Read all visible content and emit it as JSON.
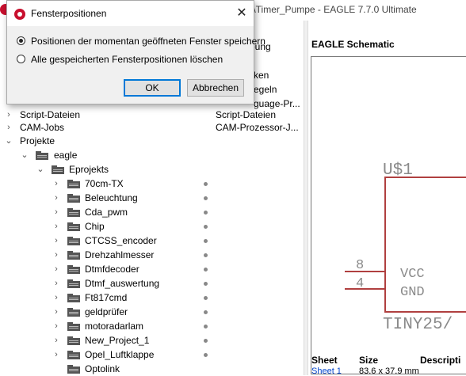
{
  "app": {
    "title": "kts\\Timer_Pumpe - EAGLE 7.7.0 Ultimate"
  },
  "columns": {
    "description": "bung"
  },
  "descriptions": [
    "ken",
    "egeln",
    "guage-Pr..."
  ],
  "tree": [
    {
      "label": "Script-Dateien",
      "desc": "Script-Dateien"
    },
    {
      "label": "CAM-Jobs",
      "desc": "CAM-Prozessor-J..."
    },
    {
      "label": "Projekte"
    },
    {
      "label": "eagle"
    },
    {
      "label": "Eprojekts"
    },
    {
      "label": "70cm-TX"
    },
    {
      "label": "Beleuchtung"
    },
    {
      "label": "Cda_pwm"
    },
    {
      "label": "Chip"
    },
    {
      "label": "CTCSS_encoder"
    },
    {
      "label": "Drehzahlmesser"
    },
    {
      "label": "Dtmfdecoder"
    },
    {
      "label": "Dtmf_auswertung"
    },
    {
      "label": "Ft817cmd"
    },
    {
      "label": "geldprüfer"
    },
    {
      "label": "motoradarlam"
    },
    {
      "label": "New_Project_1"
    },
    {
      "label": "Opel_Luftklappe"
    },
    {
      "label": "Optolink"
    }
  ],
  "preview": {
    "title": "EAGLE Schematic",
    "part_name": "U$1",
    "part_value": "TINY25/",
    "pins": [
      {
        "num": "8",
        "name": "VCC"
      },
      {
        "num": "4",
        "name": "GND"
      }
    ],
    "table_headers": [
      "Sheet",
      "Size",
      "Descripti"
    ],
    "table_row": [
      "Sheet 1",
      "83.6 x 37.9 mm",
      ""
    ]
  },
  "dialog": {
    "title": "Fensterpositionen",
    "option_save": "Positionen der momentan geöffneten Fenster speichern",
    "option_delete": "Alle gespeicherten Fensterpositionen löschen",
    "selected": "save",
    "ok_label": "OK",
    "cancel_label": "Abbrechen"
  },
  "colors": {
    "schematic_red": "#b04040",
    "schematic_text": "#8a8a8a",
    "accent": "#0078d7"
  }
}
